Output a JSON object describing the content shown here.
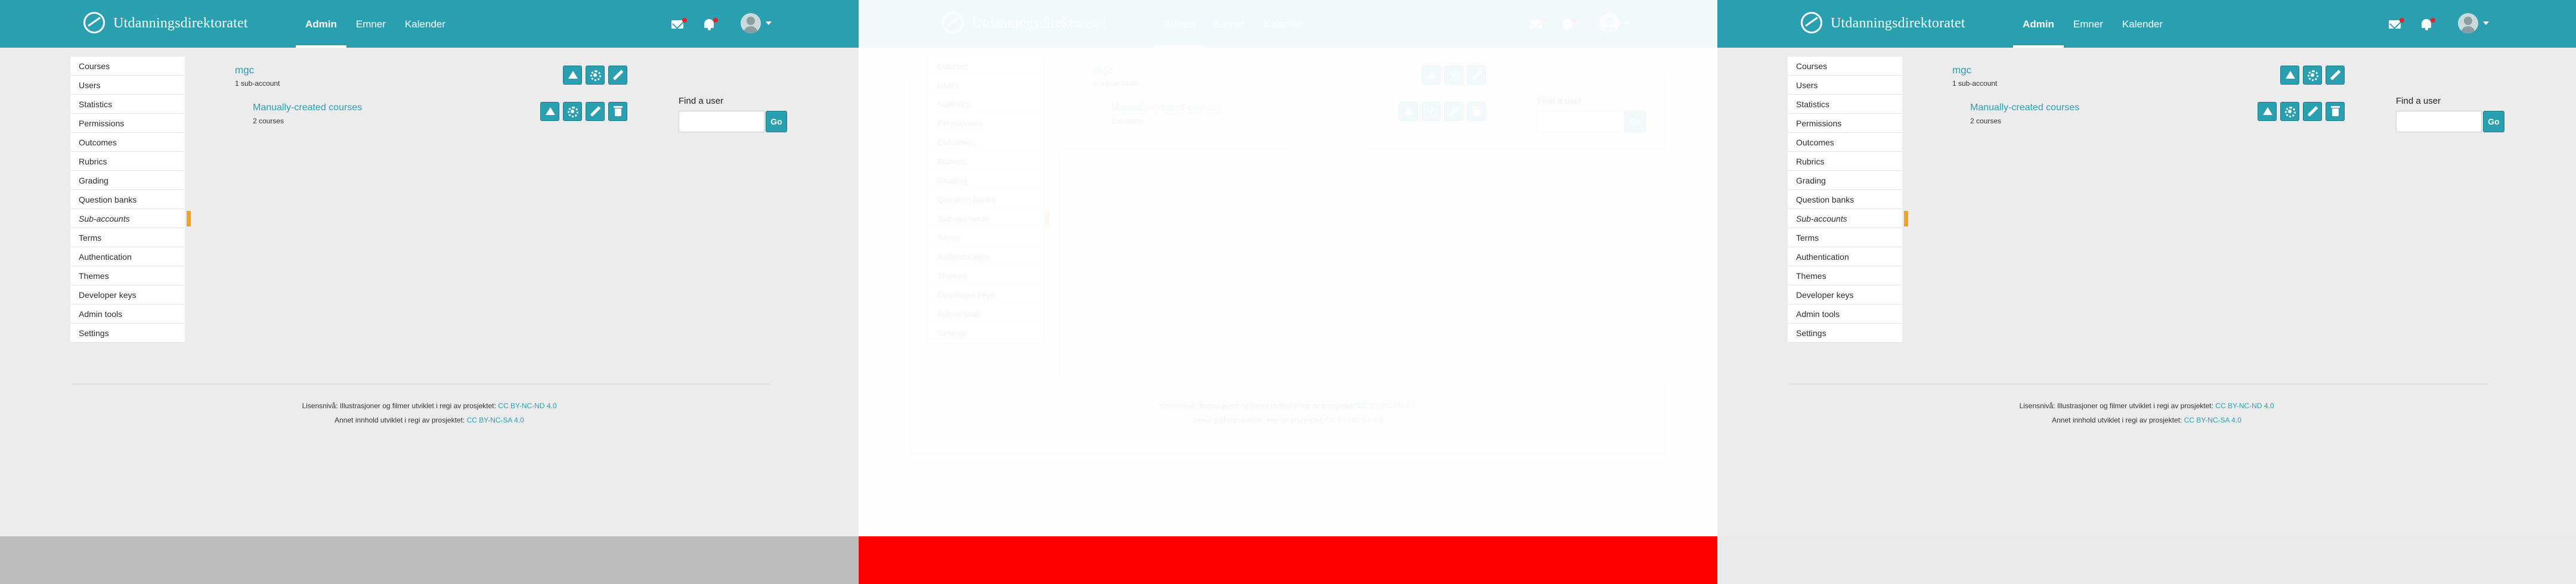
{
  "panels": [
    {
      "bottom_band_color": "#bdbdbd"
    },
    {
      "bottom_band_color": "#ff0000"
    },
    {
      "bottom_band_color": "#eaeaea"
    }
  ],
  "header": {
    "brand": "Utdanningsdirektoratet",
    "nav": [
      "Admin",
      "Emner",
      "Kalender"
    ],
    "active_nav": "Admin",
    "accent_color": "#2a9fb0",
    "notification_dot_color": "#e8202a"
  },
  "sidebar": {
    "items": [
      "Courses",
      "Users",
      "Statistics",
      "Permissions",
      "Outcomes",
      "Rubrics",
      "Grading",
      "Question banks",
      "Sub-accounts",
      "Terms",
      "Authentication",
      "Themes",
      "Developer keys",
      "Admin tools",
      "Settings"
    ],
    "active": "Sub-accounts",
    "active_marker_color": "#f3a21c"
  },
  "account": {
    "name": "mgc",
    "sub_count": "1 sub-account"
  },
  "sub_account": {
    "name": "Manually-created courses",
    "course_count": "2 courses"
  },
  "find_user": {
    "label": "Find a user",
    "input_value": "",
    "go_label": "Go"
  },
  "footer": {
    "line1_text": "Lisensnivå: Illustrasjoner og filmer utviklet i regi av prosjektet: ",
    "line1_link": "CC BY-NC-ND 4.0",
    "line2_text": "Annet innhold utviklet i regi av prosjektet: ",
    "line2_link": "CC BY-NC-SA 4.0"
  }
}
